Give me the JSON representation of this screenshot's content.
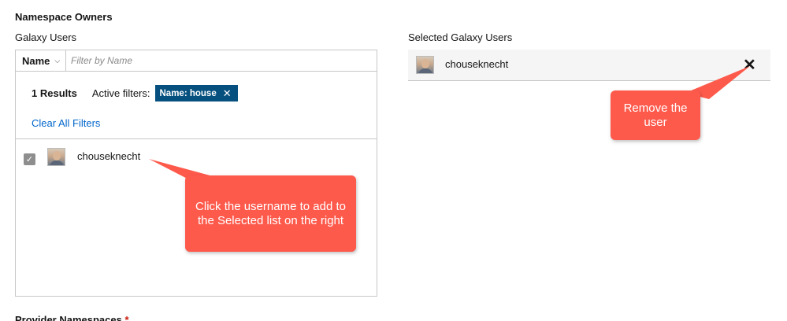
{
  "section_title": "Namespace Owners",
  "galaxy_users_label": "Galaxy Users",
  "selected_users_label": "Selected Galaxy Users",
  "filter": {
    "attribute": "Name",
    "placeholder": "Filter by Name",
    "value": ""
  },
  "results": {
    "count_text": "1 Results",
    "active_filters_label": "Active filters:",
    "chip_label": "Name: house",
    "clear_all_label": "Clear All Filters"
  },
  "user_list": [
    {
      "username": "chouseknecht",
      "checked": true
    }
  ],
  "selected_users": [
    {
      "username": "chouseknecht"
    }
  ],
  "callouts": {
    "left": "Click the username to add to the Selected list on the right",
    "right": "Remove the user"
  },
  "next_section": {
    "title": "Provider Namespaces",
    "required_marker": "*"
  },
  "colors": {
    "callout": "#fe5a4c",
    "chip": "#06507f",
    "link": "#0066cc"
  },
  "icons": {
    "dropdown": "caret-down-icon",
    "chip_remove": "close-icon",
    "checkbox": "check-icon",
    "remove_user": "close-icon"
  }
}
